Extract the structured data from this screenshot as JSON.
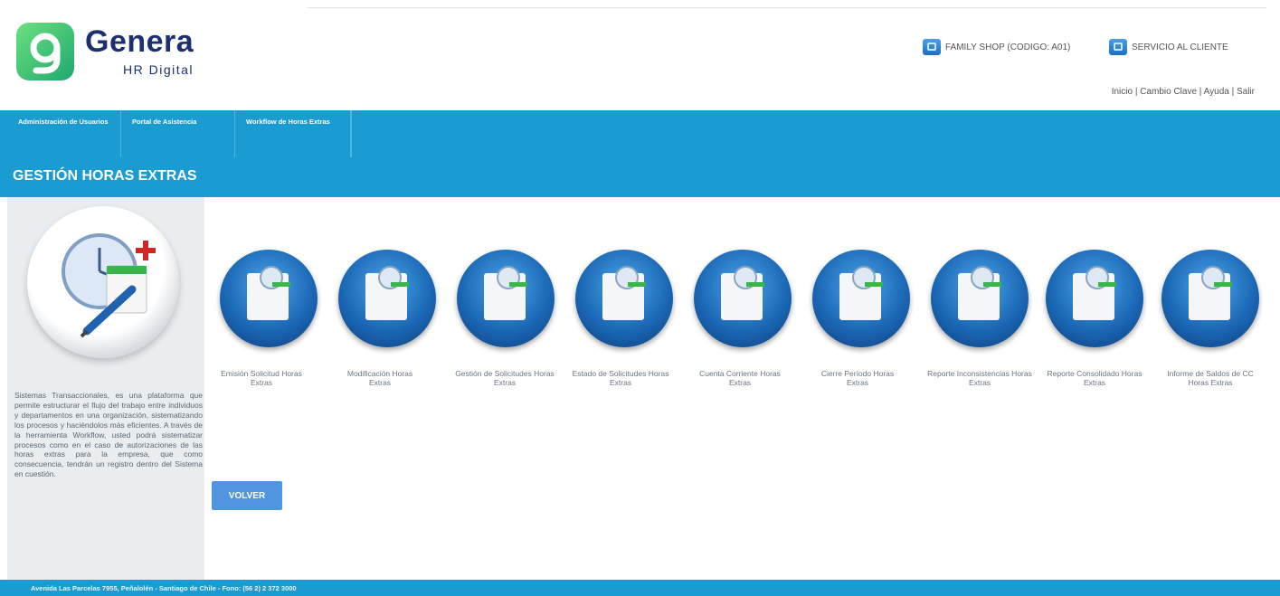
{
  "brand": {
    "name": "Genera",
    "tagline": "HR Digital",
    "logo_color": "#1fa86f",
    "text_color": "#1c2f6e"
  },
  "top_links": [
    {
      "label": "FAMILY SHOP (CODIGO: A01)",
      "icon": "building-icon"
    },
    {
      "label": "SERVICIO AL CLIENTE",
      "icon": "support-icon"
    }
  ],
  "user_links": [
    "Inicio",
    "Cambio Clave",
    "Ayuda",
    "Salir"
  ],
  "user_links_separator": " | ",
  "tabs": [
    "Administración de Usuarios",
    "Portal de Asistencia",
    "Workflow de Horas Extras"
  ],
  "page_title": "GESTIÓN HORAS EXTRAS",
  "sidebar": {
    "icon": "overtime-clock-icon",
    "description": "Sistemas Transaccionales, es una plataforma que permite estructurar el flujo del trabajo entre individuos y departamentos en una organización, sistematizando los procesos y haciéndolos más eficientes. A través de la herramienta Workflow, usted podrá sistematizar procesos como en el caso de autorizaciones de las horas extras para la empresa, que como consecuencia, tendrán un registro dentro del Sistema en cuestión."
  },
  "modules": [
    {
      "label": "Emisión Solicitud Horas Extras",
      "icon": "emit-request-icon"
    },
    {
      "label": "Modificación Horas Extras",
      "icon": "modify-icon"
    },
    {
      "label": "Gestión de Solicitudes Horas Extras",
      "icon": "manage-requests-icon"
    },
    {
      "label": "Estado de Solicitudes Horas Extras",
      "icon": "request-status-icon"
    },
    {
      "label": "Cuenta Corriente Horas Extras",
      "icon": "account-icon"
    },
    {
      "label": "Cierre Período Horas Extras",
      "icon": "close-period-icon"
    },
    {
      "label": "Reporte Inconsistencias Horas Extras",
      "icon": "inconsistency-report-icon"
    },
    {
      "label": "Reporte Consolidado Horas Extras",
      "icon": "consolidated-report-icon"
    },
    {
      "label": "Informe de Saldos de CC Horas Extras",
      "icon": "balance-report-icon"
    }
  ],
  "back_button": "VOLVER",
  "footer": "Avenida Las Parcelas 7955, Peñalolén - Santiago de Chile - Fono: (56 2) 2 372 3000",
  "colors": {
    "primary": "#1a9bd1",
    "button": "#4f95e0",
    "sidebar_bg": "#e9edf0"
  }
}
